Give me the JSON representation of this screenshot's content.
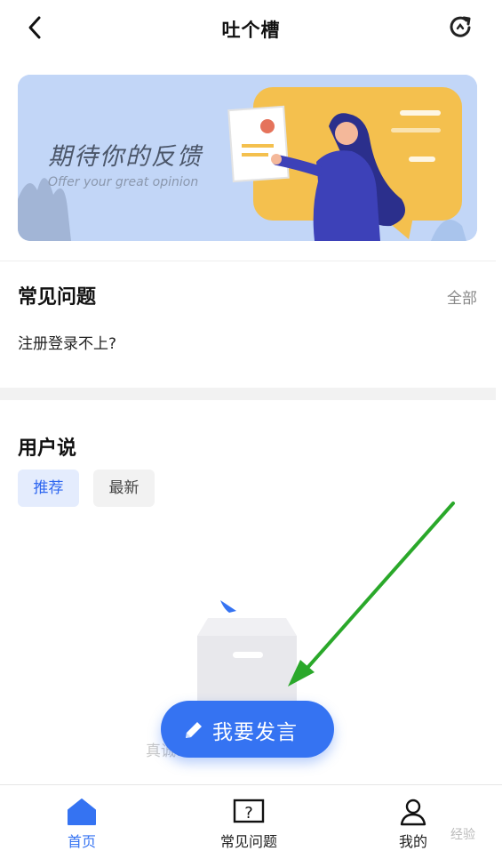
{
  "header": {
    "title": "吐个槽"
  },
  "banner": {
    "title": "期待你的反馈",
    "subtitle": "Offer your great opinion"
  },
  "faq": {
    "title": "常见问题",
    "all_label": "全部",
    "questions": [
      "注册登录不上?"
    ]
  },
  "user_say": {
    "title": "用户说",
    "tabs": [
      {
        "label": "推荐",
        "active": true
      },
      {
        "label": "最新",
        "active": false
      }
    ]
  },
  "empty_state": {
    "text": "真诚……"
  },
  "post_button": {
    "label": "我要发言"
  },
  "bottom_nav": {
    "items": [
      {
        "label": "首页",
        "icon": "home-icon",
        "active": true
      },
      {
        "label": "常见问题",
        "icon": "question-box-icon",
        "active": false
      },
      {
        "label": "我的",
        "icon": "person-icon",
        "active": false
      }
    ]
  },
  "watermark": "经验",
  "colors": {
    "accent": "#3573f2",
    "banner_bg": "#c2d6f7",
    "annotation_arrow": "#2aa82a"
  }
}
